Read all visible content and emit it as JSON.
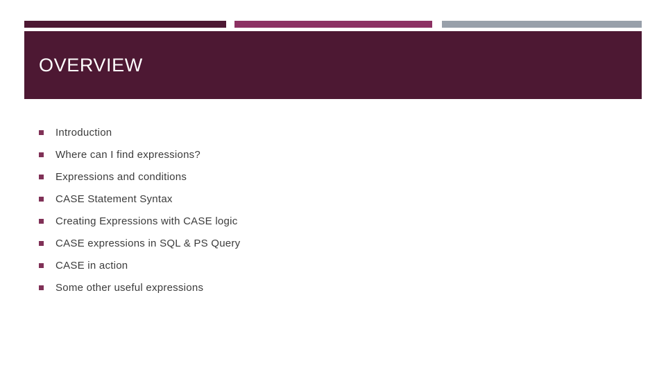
{
  "slide": {
    "title": "OVERVIEW",
    "background_color": "#FFFFFF"
  },
  "theme": {
    "dark_plum": "#4D1833",
    "magenta": "#8C3163",
    "gray": "#98A0AA",
    "bullet_color": "#803157",
    "title_text_color": "#FFFFFF",
    "body_text_color": "#3B3B3B"
  },
  "accent_bars": [
    {
      "name": "bar-dark-plum",
      "color": "#4D1833"
    },
    {
      "name": "bar-magenta",
      "color": "#8C3163"
    },
    {
      "name": "bar-gray",
      "color": "#98A0AA"
    }
  ],
  "bullets": [
    {
      "label": "Introduction"
    },
    {
      "label": "Where can I find expressions?"
    },
    {
      "label": "Expressions and conditions"
    },
    {
      "label": "CASE Statement Syntax"
    },
    {
      "label": "Creating Expressions with CASE logic"
    },
    {
      "label": "CASE expressions in SQL & PS Query"
    },
    {
      "label": "CASE in action"
    },
    {
      "label": "Some other useful expressions"
    }
  ]
}
